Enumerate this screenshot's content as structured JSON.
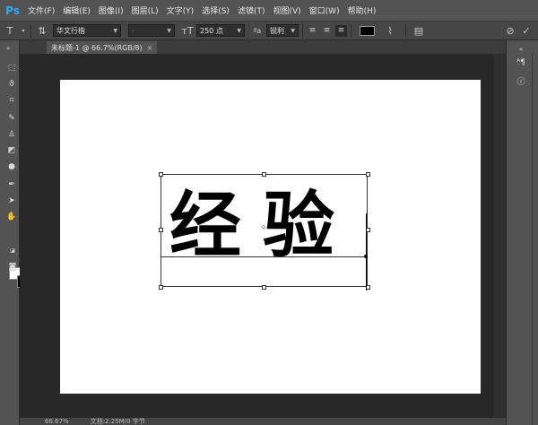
{
  "app": {
    "logo": "Ps",
    "menu": [
      "文件(F)",
      "编辑(E)",
      "图像(I)",
      "图层(L)",
      "文字(Y)",
      "选择(S)",
      "滤镜(T)",
      "视图(V)",
      "窗口(W)",
      "帮助(H)"
    ]
  },
  "options": {
    "tool_icon": "T",
    "font_family": "华文行楷",
    "font_style": "-",
    "font_size": "250 点",
    "aa_glyph": "ªa",
    "anti_alias": "锐利",
    "text_color": "#000000"
  },
  "document": {
    "tab_title": "未标题-1 @ 66.7%(RGB/8)",
    "tab_close": "×",
    "text": "经验"
  },
  "status": {
    "zoom": "66.67%",
    "doc_info": "文档:2.25M/0 字节"
  },
  "colors": {
    "foreground": "#ffffff",
    "background": "#000000"
  }
}
